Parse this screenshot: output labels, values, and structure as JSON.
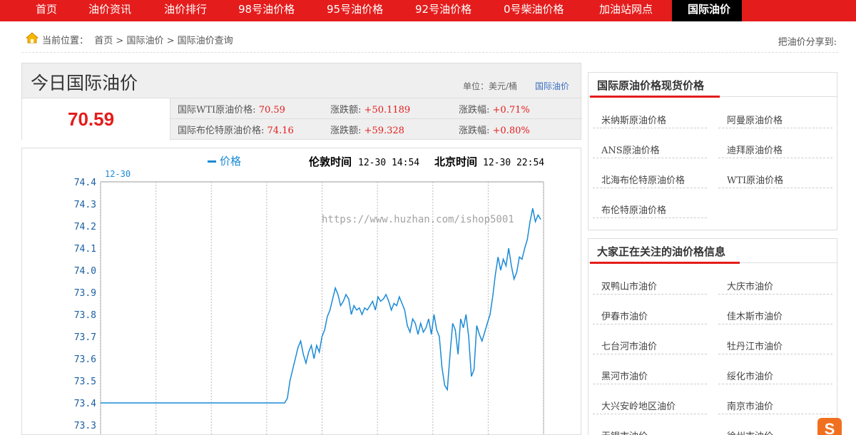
{
  "nav": {
    "items": [
      "首页",
      "油价资讯",
      "油价排行",
      "98号油价格",
      "95号油价格",
      "92号油价格",
      "0号柴油价格",
      "加油站网点",
      "国际油价"
    ],
    "active": "国际油价"
  },
  "breadcrumb": {
    "label": "当前位置：",
    "path": "首页 > 国际油价 > 国际油价查询",
    "share": "把油价分享到:"
  },
  "price": {
    "title": "今日国际油价",
    "unit": "单位：美元/桶",
    "link": "国际油价",
    "main_value": "70.59",
    "rows": [
      {
        "name": "国际WTI原油价格:",
        "value": "70.59",
        "chg_label": "涨跌额:",
        "chg": "+50.1189",
        "pct_label": "涨跌幅:",
        "pct": "+0.71%"
      },
      {
        "name": "国际布伦特原油价格:",
        "value": "74.16",
        "chg_label": "涨跌额:",
        "chg": "+59.328",
        "pct_label": "涨跌幅:",
        "pct": "+0.80%"
      }
    ]
  },
  "chart_header": {
    "legend": "价格",
    "london_label": "伦敦时间",
    "london_time": "12-30 14:54",
    "beijing_label": "北京时间",
    "beijing_time": "12-30 22:54",
    "date_label": "12-30",
    "watermark": "https://www.huzhan.com/ishop5001"
  },
  "chart_data": {
    "type": "line",
    "title": "",
    "xlabel": "",
    "ylabel": "",
    "ylim": [
      73.3,
      74.4
    ],
    "yticks": [
      "74.4",
      "74.3",
      "74.2",
      "74.1",
      "74.0",
      "73.9",
      "73.8",
      "73.7",
      "73.6",
      "73.5",
      "73.4",
      "73.3"
    ],
    "grid": true,
    "series": [
      {
        "name": "价格",
        "color": "#1a8ad6",
        "values": [
          73.4,
          73.4,
          73.4,
          73.4,
          73.4,
          73.4,
          73.4,
          73.4,
          73.4,
          73.4,
          73.4,
          73.4,
          73.4,
          73.4,
          73.4,
          73.4,
          73.4,
          73.4,
          73.4,
          73.4,
          73.4,
          73.4,
          73.4,
          73.4,
          73.4,
          73.4,
          73.4,
          73.4,
          73.4,
          73.4,
          73.4,
          73.4,
          73.4,
          73.4,
          73.4,
          73.4,
          73.4,
          73.4,
          73.4,
          73.4,
          73.4,
          73.4,
          73.4,
          73.4,
          73.4,
          73.4,
          73.4,
          73.4,
          73.4,
          73.4,
          73.4,
          73.4,
          73.4,
          73.4,
          73.4,
          73.4,
          73.4,
          73.4,
          73.4,
          73.4,
          73.4,
          73.4,
          73.4,
          73.4,
          73.4,
          73.4,
          73.4,
          73.4,
          73.4,
          73.4,
          73.42,
          73.5,
          73.55,
          73.6,
          73.65,
          73.68,
          73.62,
          73.58,
          73.63,
          73.66,
          73.6,
          73.66,
          73.63,
          73.7,
          73.73,
          73.79,
          73.82,
          73.87,
          73.92,
          73.89,
          73.84,
          73.86,
          73.89,
          73.87,
          73.8,
          73.84,
          73.82,
          73.83,
          73.8,
          73.83,
          73.82,
          73.84,
          73.86,
          73.82,
          73.88,
          73.86,
          73.87,
          73.89,
          73.86,
          73.82,
          73.85,
          73.84,
          73.88,
          73.85,
          73.82,
          73.75,
          73.72,
          73.78,
          73.76,
          73.71,
          73.76,
          73.72,
          73.74,
          73.78,
          73.71,
          73.8,
          73.73,
          73.7,
          73.56,
          73.48,
          73.46,
          73.62,
          73.76,
          73.73,
          73.62,
          73.78,
          73.74,
          73.8,
          73.7,
          73.52,
          73.55,
          73.75,
          73.71,
          73.68,
          73.72,
          73.76,
          73.8,
          73.88,
          73.98,
          74.06,
          74.0,
          74.05,
          74.02,
          74.1,
          74.02,
          73.96,
          73.99,
          74.06,
          74.05,
          74.1,
          74.14,
          74.22,
          74.28,
          74.22,
          74.25,
          74.23
        ]
      }
    ]
  },
  "sidebar": {
    "box1": {
      "title": "国际原油价格现货价格",
      "items": [
        "米纳斯原油价格",
        "阿曼原油价格",
        "ANS原油价格",
        "迪拜原油价格",
        "北海布伦特原油价格",
        "WTI原油价格",
        "布伦特原油价格"
      ]
    },
    "box2": {
      "title": "大家正在关注的油价格信息",
      "items": [
        "双鸭山市油价",
        "大庆市油价",
        "伊春市油价",
        "佳木斯市油价",
        "七台河市油价",
        "牡丹江市油价",
        "黑河市油价",
        "绥化市油价",
        "大兴安岭地区油价",
        "南京市油价",
        "无锡市油价",
        "徐州市油价"
      ]
    }
  },
  "colors": {
    "brand": "#e41c1c",
    "line": "#1a8ad6",
    "link": "#3a6ec0"
  }
}
